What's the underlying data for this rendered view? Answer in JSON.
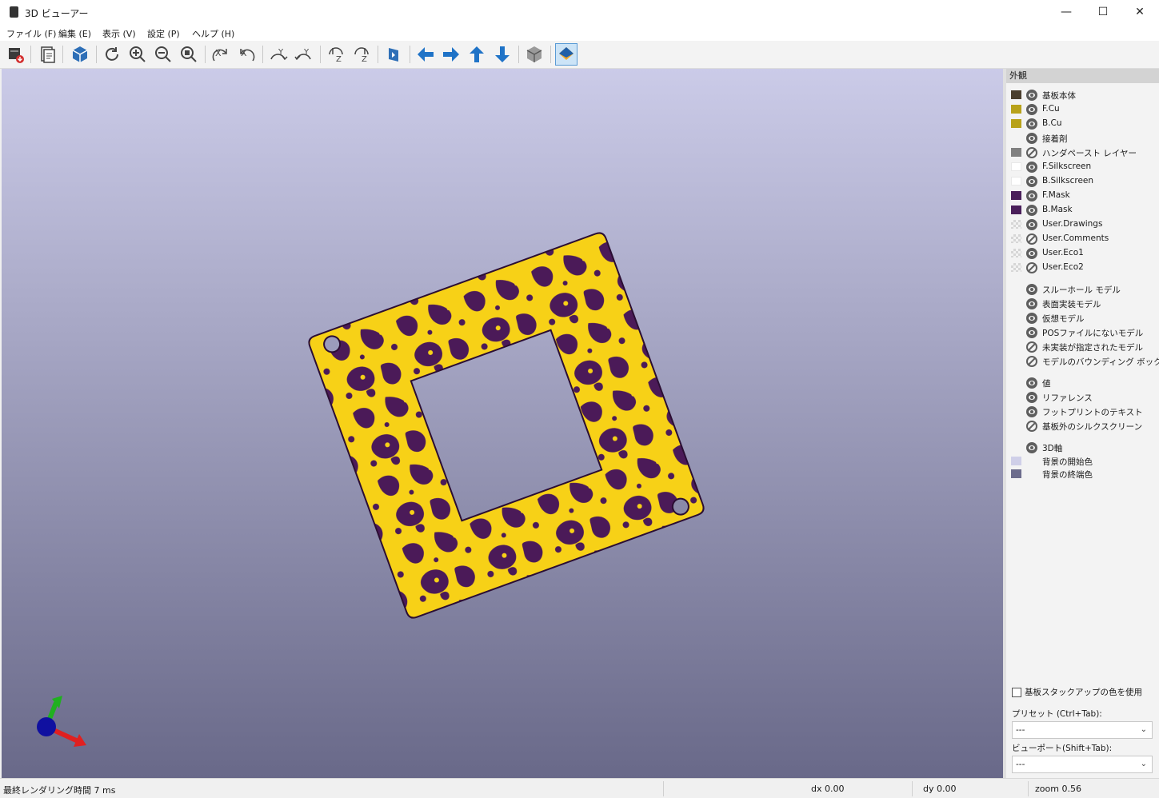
{
  "window": {
    "title": "3D ビューアー",
    "minimize": "—",
    "maximize": "☐",
    "close": "✕"
  },
  "menu": [
    "ファイル (F)",
    "編集 (E)",
    "表示 (V)",
    "設定 (P)",
    "ヘルプ (H)"
  ],
  "toolbar_icons": [
    "export-icon",
    "copy-image-icon",
    "board-3d-icon",
    "reload-icon",
    "zoom-in-icon",
    "zoom-out-icon",
    "zoom-fit-icon",
    "rotate-x-cw-icon",
    "rotate-x-ccw-icon",
    "rotate-y-cw-icon",
    "rotate-y-ccw-icon",
    "rotate-z-cw-icon",
    "rotate-z-ccw-icon",
    "flip-board-icon",
    "move-left-icon",
    "move-right-icon",
    "move-up-icon",
    "move-down-icon",
    "orthographic-icon",
    "layers-manager-icon"
  ],
  "appearance": {
    "header": "外観",
    "layers": [
      {
        "label": "基板本体",
        "color": "#4b3f2e",
        "visible": true
      },
      {
        "label": "F.Cu",
        "color": "#b8a21a",
        "visible": true
      },
      {
        "label": "B.Cu",
        "color": "#b8a21a",
        "visible": true
      },
      {
        "label": "接着剤",
        "color": "",
        "visible": true
      },
      {
        "label": "ハンダペースト レイヤー",
        "color": "#808080",
        "visible": false
      },
      {
        "label": "F.Silkscreen",
        "color": "#ffffff",
        "visible": true
      },
      {
        "label": "B.Silkscreen",
        "color": "#ffffff",
        "visible": true
      },
      {
        "label": "F.Mask",
        "color": "#4a1f5a",
        "visible": true
      },
      {
        "label": "B.Mask",
        "color": "#4a1f5a",
        "visible": true
      },
      {
        "label": "User.Drawings",
        "color": "checker",
        "visible": true
      },
      {
        "label": "User.Comments",
        "color": "checker",
        "visible": false
      },
      {
        "label": "User.Eco1",
        "color": "checker",
        "visible": true
      },
      {
        "label": "User.Eco2",
        "color": "checker",
        "visible": false
      }
    ],
    "models": [
      {
        "label": "スルーホール モデル",
        "visible": true
      },
      {
        "label": "表面実装モデル",
        "visible": true
      },
      {
        "label": "仮想モデル",
        "visible": true
      },
      {
        "label": "POSファイルにないモデル",
        "visible": true
      },
      {
        "label": "未実装が指定されたモデル",
        "visible": false
      },
      {
        "label": "モデルのバウンディング ボックス",
        "visible": false
      }
    ],
    "texts": [
      {
        "label": "値",
        "visible": true
      },
      {
        "label": "リファレンス",
        "visible": true
      },
      {
        "label": "フットプリントのテキスト",
        "visible": true
      },
      {
        "label": "基板外のシルクスクリーン",
        "visible": false
      }
    ],
    "misc": [
      {
        "label": "3D軸",
        "visible": true,
        "color": ""
      },
      {
        "label": "背景の開始色",
        "visible": null,
        "color": "#cfcfe8"
      },
      {
        "label": "背景の終端色",
        "visible": null,
        "color": "#6c6c8c"
      }
    ],
    "use_stackup_colors": "基板スタックアップの色を使用",
    "preset_label": "プリセット (Ctrl+Tab):",
    "preset_value": "---",
    "viewport_label": "ビューポート(Shift+Tab):",
    "viewport_value": "---"
  },
  "status": {
    "render_time": "最終レンダリング時間 7 ms",
    "dx": "dx 0.00",
    "dy": "dy 0.00",
    "zoom": "zoom 0.56"
  }
}
